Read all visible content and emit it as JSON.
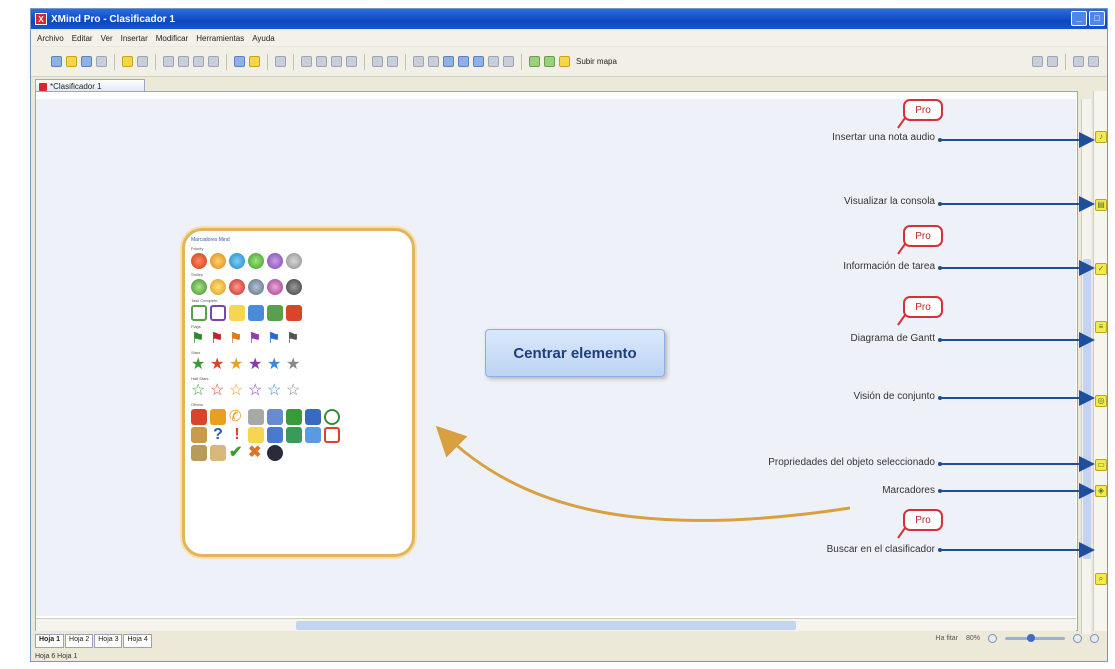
{
  "window": {
    "title": "XMind Pro - Clasificador 1"
  },
  "menu": [
    "Archivo",
    "Editar",
    "Ver",
    "Insertar",
    "Modificar",
    "Herramientas",
    "Ayuda"
  ],
  "toolbar": {
    "save_label": "Subir mapa"
  },
  "editor_tab": {
    "label": "*Clasificador 1"
  },
  "panel": {
    "title": "Marcadores Mind",
    "sections": [
      "Priority",
      "Smiley",
      "Task Complete",
      "Flags",
      "Stars",
      "Half Stars",
      "Others"
    ]
  },
  "callout": {
    "text": "Centrar elemento"
  },
  "annotations": [
    {
      "label": "Insertar una nota audio",
      "pro": true
    },
    {
      "label": "Visualizar la consola",
      "pro": false
    },
    {
      "label": "Información de tarea",
      "pro": true
    },
    {
      "label": "Diagrama de Gantt",
      "pro": true
    },
    {
      "label": "Visión de conjunto",
      "pro": false
    },
    {
      "label": "Propriedades del objeto seleccionado",
      "pro": false
    },
    {
      "label": "Marcadores",
      "pro": false
    },
    {
      "label": "Buscar en el clasificador",
      "pro": true
    }
  ],
  "pro_label": "Pro",
  "sheets": [
    "Hoja 1",
    "Hoja 2",
    "Hoja 3",
    "Hoja 4"
  ],
  "zoom": {
    "value": "80%",
    "fit": "Ha fitar"
  },
  "status": {
    "text": "Hoja 6 Hoja 1"
  },
  "colors": {
    "accent": "#1f5fb8",
    "pro_border": "#d6303a",
    "callout_bg": "#cfdff7",
    "panel_border": "#e3b55b"
  }
}
